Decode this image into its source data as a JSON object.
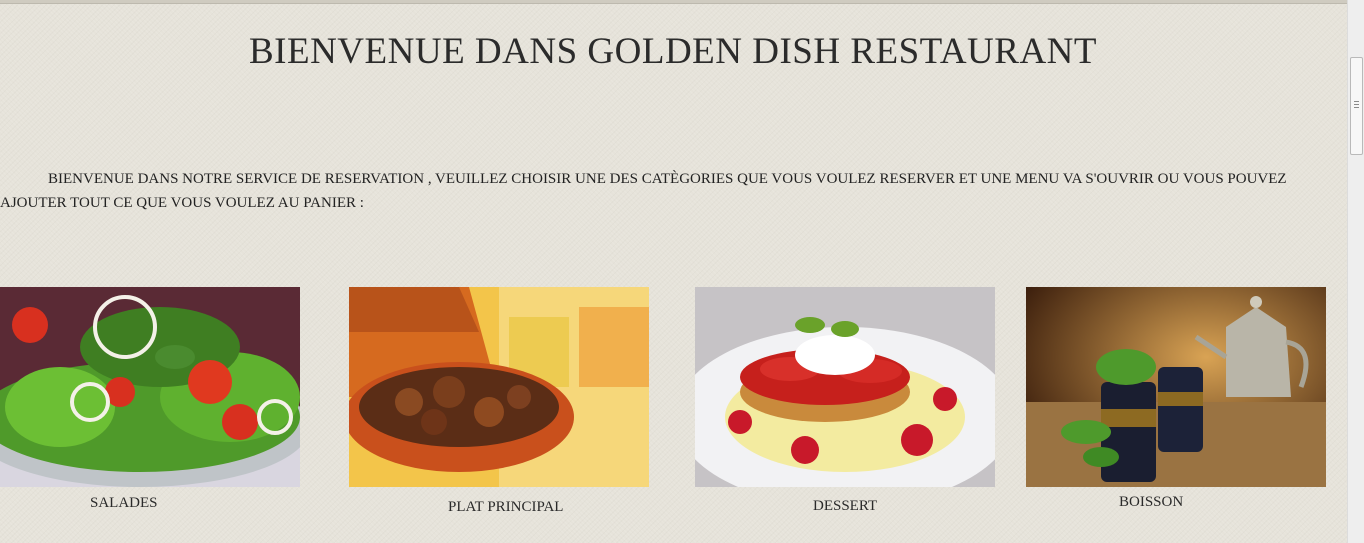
{
  "header": {
    "title": "BIENVENUE DANS GOLDEN DISH RESTAURANT"
  },
  "intro": {
    "text": "BIENVENUE DANS NOTRE SERVICE DE RESERVATION , VEUILLEZ CHOISIR UNE DES CATÈGORIES QUE VOUS VOULEZ RESERVER ET UNE MENU VA S'OUVRIR OU VOUS POUVEZ AJOUTER TOUT CE QUE VOUS VOULEZ AU PANIER :"
  },
  "categories": [
    {
      "label": "SALADES"
    },
    {
      "label": "PLAT PRINCIPAL"
    },
    {
      "label": "DESSERT"
    },
    {
      "label": "BOISSON"
    }
  ],
  "colors": {
    "background": "#e6e3da",
    "text": "#2a2a2a"
  }
}
